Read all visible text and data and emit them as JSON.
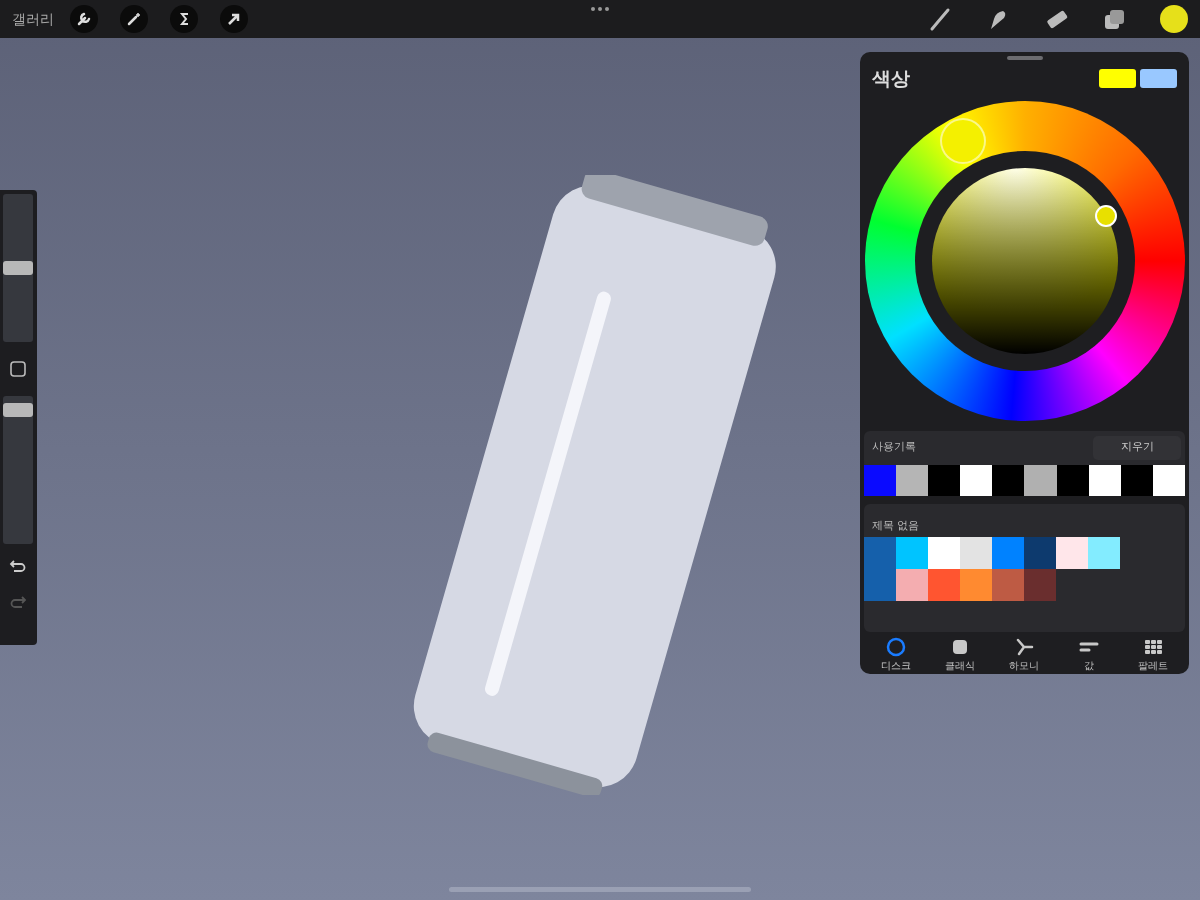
{
  "topbar": {
    "gallery": "갤러리",
    "current_color": {
      "color": "#e6e01a"
    }
  },
  "sidebar": {
    "size_slider": {
      "level": 0.5
    },
    "opacity_slider": {
      "level": 0.95
    }
  },
  "color_panel": {
    "title": "색상",
    "swatches": [
      {
        "color": "#ffff00"
      },
      {
        "color": "#99c8ff"
      }
    ],
    "history": {
      "label": "사용기록",
      "clear_button": "지우기",
      "colors": [
        {
          "color": "#0a0aff"
        },
        {
          "color": "#b5b5b5"
        },
        {
          "color": "#000000"
        },
        {
          "color": "#ffffff"
        },
        {
          "color": "#000000"
        },
        {
          "color": "#b0b0b0"
        },
        {
          "color": "#000000"
        },
        {
          "color": "#ffffff"
        },
        {
          "color": "#000000"
        },
        {
          "color": "#ffffff"
        }
      ]
    },
    "palette": {
      "title": "제목 없음",
      "colors": [
        {
          "color": "#1560ab",
          "kind": "tall"
        },
        {
          "color": "#00c4ff",
          "kind": "cell"
        },
        {
          "color": "#ffffff",
          "kind": "cell"
        },
        {
          "color": "#e3e3e3",
          "kind": "cell"
        },
        {
          "color": "#0082ff",
          "kind": "cell"
        },
        {
          "color": "#0d3a6e",
          "kind": "cell"
        },
        {
          "color": "#ffe6ea",
          "kind": "cell"
        },
        {
          "color": "#83ecff",
          "kind": "cell"
        },
        {
          "color": "#f4adb0",
          "kind": "cell"
        },
        {
          "color": "#ff5530",
          "kind": "cell"
        },
        {
          "color": "#ff8a30",
          "kind": "cell"
        },
        {
          "color": "#be5b44",
          "kind": "cell"
        },
        {
          "color": "#6a2e2e",
          "kind": "cell"
        }
      ]
    },
    "tabs": [
      {
        "label": "디스크",
        "kind": "disc",
        "selected": true
      },
      {
        "label": "클래식",
        "kind": "classic",
        "selected": false
      },
      {
        "label": "하모니",
        "kind": "harmony",
        "selected": false
      },
      {
        "label": "값",
        "kind": "value",
        "selected": false
      },
      {
        "label": "팔레트",
        "kind": "palette",
        "selected": false
      }
    ]
  }
}
